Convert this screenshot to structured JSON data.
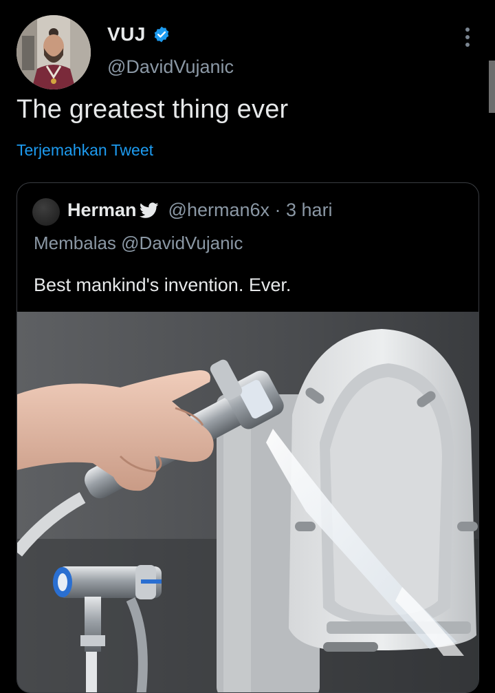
{
  "tweet": {
    "display_name": "VUJ",
    "handle": "@DavidVujanic",
    "text": "The greatest thing ever",
    "translate_label": "Terjemahkan Tweet",
    "verified_icon": "verified-badge-icon",
    "more_icon": "more-options-icon"
  },
  "quote": {
    "name": "Herman",
    "badge_icon": "twitter-bird-icon",
    "handle_time": "@herman6x · 3 hari",
    "reply_to": "Membalas @DavidVujanic",
    "text": "Best mankind's invention. Ever."
  },
  "colors": {
    "background": "#000000",
    "text": "#e7e9ea",
    "secondary": "#8b98a5",
    "link": "#1d9bf0"
  }
}
